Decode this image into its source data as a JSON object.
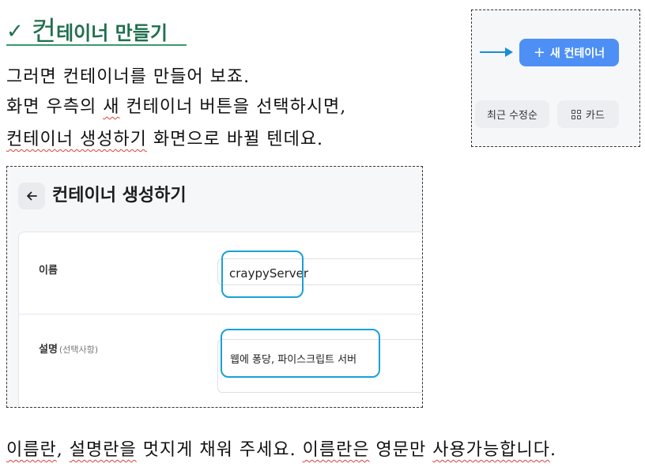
{
  "heading": {
    "check": "✓",
    "title_first": "컨",
    "title_rest": "테이너 만들기"
  },
  "paragraphs": {
    "p1": "그러면 컨테이너를 만들어 보죠.",
    "p2_a": "화면 우측의 ",
    "p2_b": "새",
    "p2_c": " 컨테이너 버튼을 선택하시면,",
    "p3_a": "컨테이너 생성하기",
    "p3_b": " 화면으로 바뀔 텐데요.",
    "p4_a": "이름란",
    "p4_b": ", ",
    "p4_c": "설명란을",
    "p4_d": " 멋지게 채워 주세요. ",
    "p4_e": "이름란은",
    "p4_f": " 영문만 ",
    "p4_g": "사용가능합니다",
    "p4_h": "."
  },
  "mini_shot": {
    "new_button_label": "새 컨테이너",
    "plus": "+",
    "sort_button_label": "최근 수정순",
    "card_button_label": "카드",
    "accent_color": "#4d8ff5",
    "arrow_color": "#1a8cd8"
  },
  "main_shot": {
    "page_title": "컨테이너 생성하기",
    "name_label": "이름",
    "name_value": "craypyServer",
    "desc_label": "설명",
    "desc_optional": "(선택사항)",
    "desc_value": "웹에 퐁당, 파이스크립트 서버",
    "highlight_color": "#1aa0d8"
  }
}
